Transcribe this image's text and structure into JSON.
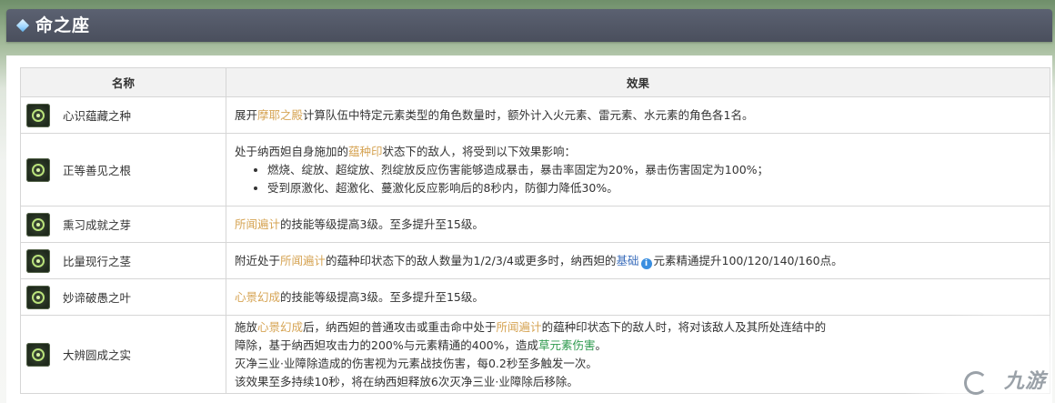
{
  "header": {
    "title": "命之座"
  },
  "table": {
    "headers": [
      "名称",
      "效果"
    ],
    "rows": [
      {
        "name": "心识蕴藏之种",
        "icon": "constellation-seed-icon",
        "effect": [
          {
            "t": "展开"
          },
          {
            "t": "摩耶之殿",
            "s": "hl"
          },
          {
            "t": "计算队伍中特定元素类型的角色数量时，额外计入火元素、雷元素、水元素的角色各1名。"
          }
        ]
      },
      {
        "name": "正等善见之根",
        "icon": "constellation-root-icon",
        "effect_intro": [
          {
            "t": "处于纳西妲自身施加的"
          },
          {
            "t": "蕴种印",
            "s": "hl"
          },
          {
            "t": "状态下的敌人，将受到以下效果影响："
          }
        ],
        "bullets": [
          "燃烧、绽放、超绽放、烈绽放反应伤害能够造成暴击，暴击率固定为20%，暴击伤害固定为100%；",
          "受到原激化、超激化、蔓激化反应影响后的8秒内，防御力降低30%。"
        ]
      },
      {
        "name": "熏习成就之芽",
        "icon": "constellation-sprout-icon",
        "effect": [
          {
            "t": "所闻遍计",
            "s": "hl"
          },
          {
            "t": "的技能等级提高3级。至多提升至15级。"
          }
        ]
      },
      {
        "name": "比量现行之茎",
        "icon": "constellation-stem-icon",
        "effect": [
          {
            "t": "附近处于"
          },
          {
            "t": "所闻遍计",
            "s": "hl"
          },
          {
            "t": "的蕴种印状态下的敌人数量为1/2/3/4或更多时，纳西妲的"
          },
          {
            "t": "基础",
            "s": "hl-link"
          },
          {
            "t": "i",
            "s": "info-dot"
          },
          {
            "t": "元素精通提升100/120/140/160点。"
          }
        ]
      },
      {
        "name": "妙谛破愚之叶",
        "icon": "constellation-leaf-icon",
        "effect": [
          {
            "t": "心景幻成",
            "s": "hl"
          },
          {
            "t": "的技能等级提高3级。至多提升至15级。"
          }
        ]
      },
      {
        "name": "大辨圆成之实",
        "icon": "constellation-fruit-icon",
        "effect_lines": [
          [
            {
              "t": "施放"
            },
            {
              "t": "心景幻成",
              "s": "hl"
            },
            {
              "t": "后，纳西妲的普通攻击或重击命中处于"
            },
            {
              "t": "所闻遍计",
              "s": "hl"
            },
            {
              "t": "的蕴种印状态下的敌人时，将对该敌人及其所处连结中的"
            }
          ],
          [
            {
              "t": "障除，基于纳西妲攻击力的200%与元素精通的400%，造成"
            },
            {
              "t": "草元素伤害",
              "s": "hl-green"
            },
            {
              "t": "。"
            }
          ],
          [
            {
              "t": "灭净三业·业障除造成的伤害视为元素战技伤害，每0.2秒至多触发一次。"
            }
          ],
          [
            {
              "t": "该效果至多持续10秒，将在纳西妲释放6次灭净三业·业障除后移除。"
            }
          ]
        ]
      }
    ]
  },
  "watermark": {
    "brand": "九游"
  }
}
